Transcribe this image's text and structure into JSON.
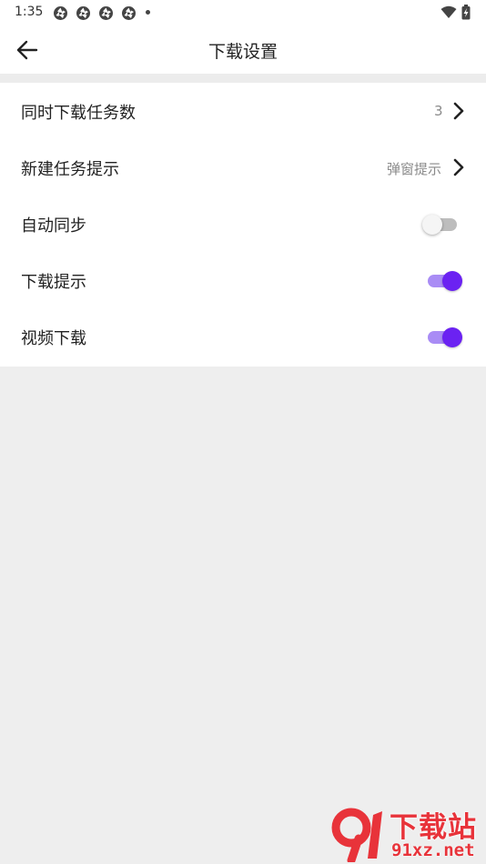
{
  "status_bar": {
    "time": "1:35",
    "notification_icons": [
      "aperture-icon",
      "aperture-icon",
      "aperture-icon",
      "aperture-icon"
    ],
    "right_icons": [
      "wifi-icon",
      "battery-icon"
    ]
  },
  "header": {
    "title": "下载设置",
    "back_icon": "arrow-left-icon"
  },
  "settings": {
    "concurrent_tasks": {
      "label": "同时下载任务数",
      "value": "3"
    },
    "new_task_prompt": {
      "label": "新建任务提示",
      "value": "弹窗提示"
    },
    "auto_sync": {
      "label": "自动同步",
      "enabled": false
    },
    "download_prompt": {
      "label": "下载提示",
      "enabled": true
    },
    "video_download": {
      "label": "视频下载",
      "enabled": true
    }
  },
  "watermark": {
    "title": "下载站",
    "url": "91xz.net"
  },
  "colors": {
    "accent": "#6b22f2",
    "accent_track": "#a98cf5",
    "background": "#eeeeee",
    "watermark": "#e8333a"
  }
}
